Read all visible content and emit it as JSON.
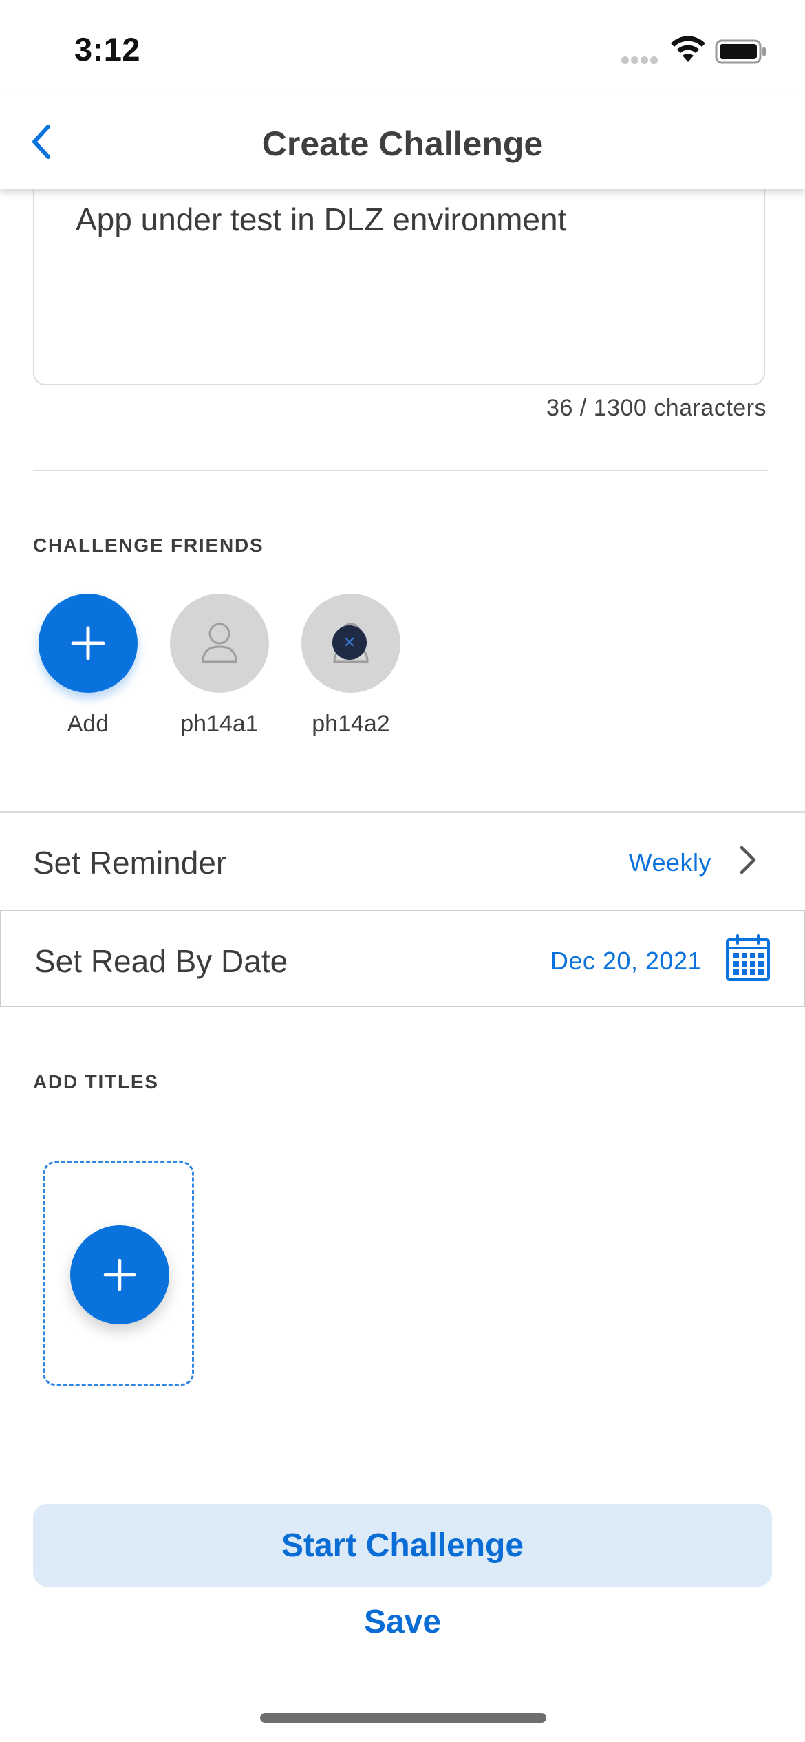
{
  "status_bar": {
    "time": "3:12"
  },
  "header": {
    "title": "Create Challenge"
  },
  "description": {
    "text": "App under test in DLZ environment",
    "char_count": "36 / 1300 characters"
  },
  "friends": {
    "heading": "CHALLENGE FRIENDS",
    "items": [
      {
        "label": "Add"
      },
      {
        "label": "ph14a1"
      },
      {
        "label": "ph14a2"
      }
    ]
  },
  "reminder": {
    "label": "Set Reminder",
    "value": "Weekly"
  },
  "read_by": {
    "label": "Set Read By Date",
    "value": "Dec 20, 2021"
  },
  "titles": {
    "heading": "ADD TITLES"
  },
  "actions": {
    "start_label": "Start Challenge",
    "save_label": "Save"
  },
  "colors": {
    "accent": "#0a72dd",
    "accent_light": "#ddeaf8",
    "avatar_grey": "#d5d5d5"
  }
}
